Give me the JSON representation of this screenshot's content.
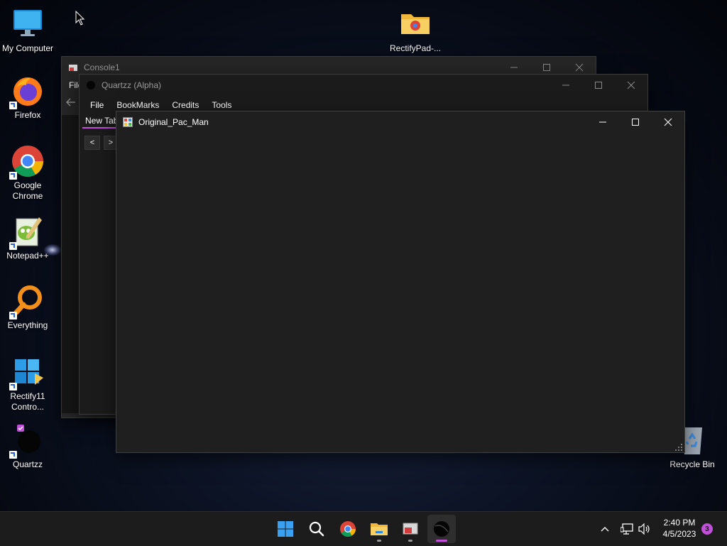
{
  "desktop": {
    "icons": [
      {
        "label": "My Computer"
      },
      {
        "label": "Firefox"
      },
      {
        "label": "Google Chrome"
      },
      {
        "label": "Notepad++"
      },
      {
        "label": "Everything"
      },
      {
        "label": "Rectify11 Contro..."
      },
      {
        "label": "Quartzz"
      },
      {
        "label": "RectifyPad-..."
      },
      {
        "label": "Recycle Bin"
      }
    ]
  },
  "windows": {
    "console": {
      "title": "Console1",
      "menu_file": "File"
    },
    "quartzz": {
      "title": "Quartzz (Alpha)",
      "menu": [
        "File",
        "BookMarks",
        "Credits",
        "Tools"
      ],
      "tab_label": "New Tab",
      "back_label": "<",
      "forward_label": ">"
    },
    "pacman": {
      "title": "Original_Pac_Man"
    }
  },
  "taskbar": {
    "time": "2:40 PM",
    "date": "4/5/2023",
    "notification_count": "3",
    "apps": [
      "start-icon",
      "search-icon",
      "chrome-icon",
      "file-explorer-icon",
      "console-icon",
      "quartzz-icon"
    ]
  },
  "colors": {
    "accent": "#c150d8",
    "window_bg": "#1e1e1e",
    "taskbar_bg": "#1c1c1c"
  }
}
